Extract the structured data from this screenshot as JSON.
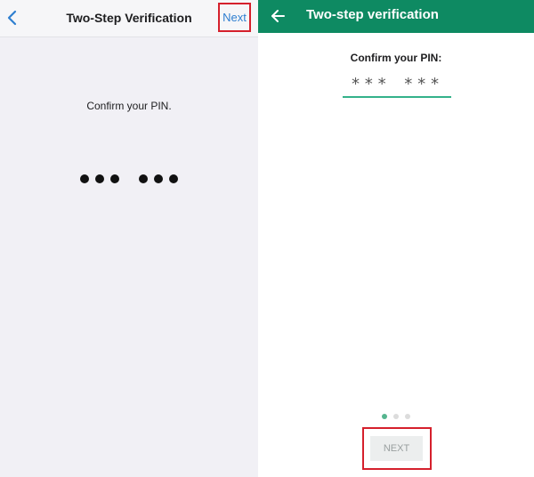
{
  "ios": {
    "header": {
      "back_icon": "chevron-left-icon",
      "title": "Two-Step Verification",
      "next_label": "Next"
    },
    "prompt": "Confirm your PIN.",
    "pin_dots": {
      "filled": 6,
      "group_size": 3
    }
  },
  "android": {
    "header": {
      "back_icon": "arrow-left-icon",
      "title": "Two-step verification",
      "color": "#0e8a62"
    },
    "prompt": "Confirm your PIN:",
    "pin_value": "*** ***",
    "pager": {
      "pages": 3,
      "active": 1
    },
    "next_label": "NEXT"
  },
  "highlight_color": "#d5202c"
}
